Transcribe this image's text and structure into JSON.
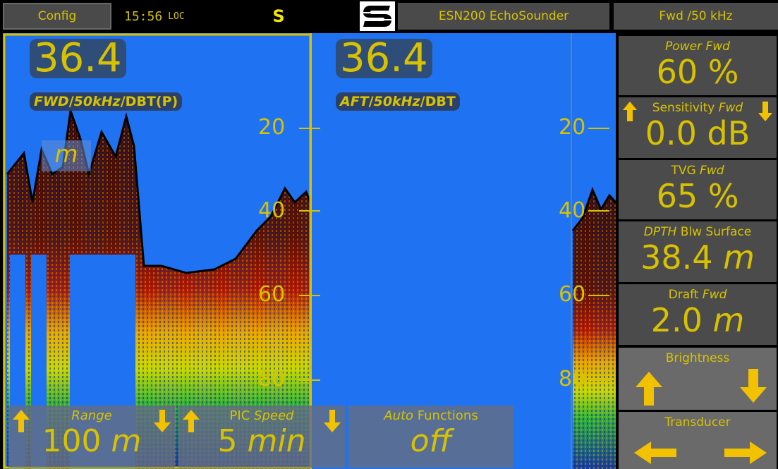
{
  "top_bar": {
    "config_label": "Config",
    "clock_time": "15:56",
    "clock_zone": "LOC",
    "mode": "S",
    "title": "ESN200 EchoSounder",
    "channel": "Fwd /50 kHz"
  },
  "echogram": {
    "left": {
      "depth": "36.4",
      "source": "FWD",
      "freq": "50kHz",
      "datum": "DBT(P)",
      "unit": "m"
    },
    "right": {
      "depth": "36.4",
      "source": "AFT",
      "freq": "50kHz",
      "datum": "DBT"
    },
    "depth_ticks": [
      "20",
      "40",
      "60",
      "80"
    ]
  },
  "bottom_buttons": [
    {
      "label_italic": "Range",
      "label_plain": "",
      "value": "100",
      "unit": "m"
    },
    {
      "label_plain": "PIC",
      "label_italic": "Speed",
      "value": "5",
      "unit": "min"
    },
    {
      "label_italic": "Auto",
      "label_plain": "Functions",
      "value": "off"
    }
  ],
  "right_panel": {
    "power": {
      "label_italic": "Power Fwd",
      "value": "60 %"
    },
    "sensitivity": {
      "label_plain": "Sensitivity",
      "label_italic": "Fwd",
      "value": "0.0 dB"
    },
    "tvg": {
      "label_plain": "TVG",
      "label_italic": "Fwd",
      "value": "65 %"
    },
    "depth": {
      "label_italic": "DPTH",
      "label_plain": "Blw Surface",
      "value": "38.4",
      "unit": "m"
    },
    "draft": {
      "label_plain": "Draft",
      "label_italic": "Fwd",
      "value": "2.0",
      "unit": "m"
    },
    "brightness_label": "Brightness",
    "transducer_label": "Transducer"
  },
  "colors": {
    "accent": "#d8c200",
    "water": "#1f73f2",
    "panel": "#4b4b4b"
  }
}
